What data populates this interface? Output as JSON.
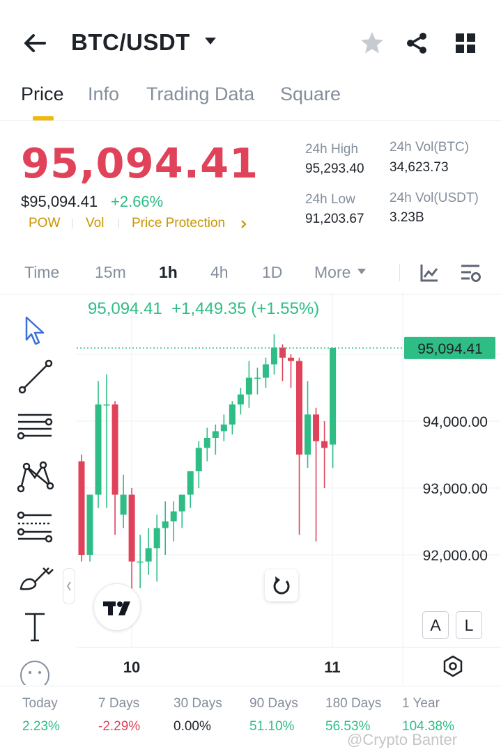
{
  "header": {
    "pair": "BTC/USDT",
    "icons": [
      "back-arrow-icon",
      "caret-down-icon",
      "star-icon",
      "share-icon",
      "grid-icon"
    ]
  },
  "tabs": [
    {
      "label": "Price",
      "active": true
    },
    {
      "label": "Info",
      "active": false
    },
    {
      "label": "Trading Data",
      "active": false
    },
    {
      "label": "Square",
      "active": false
    }
  ],
  "price": {
    "last": "95,094.41",
    "usd": "$95,094.41",
    "change_pct": "+2.66%",
    "tags": [
      "POW",
      "Vol",
      "Price Protection"
    ]
  },
  "stats": {
    "high_label": "24h High",
    "high_value": "95,293.40",
    "low_label": "24h Low",
    "low_value": "91,203.67",
    "vol_btc_label": "24h Vol(BTC)",
    "vol_btc_value": "34,623.73",
    "vol_usdt_label": "24h Vol(USDT)",
    "vol_usdt_value": "3.23B"
  },
  "intervals": [
    {
      "label": "Time",
      "active": false
    },
    {
      "label": "15m",
      "active": false
    },
    {
      "label": "1h",
      "active": true
    },
    {
      "label": "4h",
      "active": false
    },
    {
      "label": "1D",
      "active": false
    },
    {
      "label": "More",
      "active": false
    }
  ],
  "chart": {
    "ohlc_line": "95,094.41  +1,449.35 (+1.55%)",
    "current_price_label": "95,094.41",
    "reset_buttons": {
      "a": "A",
      "l": "L"
    },
    "x_ticks": [
      "10",
      "11"
    ]
  },
  "chart_data": {
    "type": "candlestick",
    "y_ticks": [
      92000,
      93000,
      94000
    ],
    "y_tick_labels": [
      "92,000.00",
      "93,000.00",
      "94,000.00"
    ],
    "current_price": 95094.41,
    "x_ticks": [
      "10",
      "11"
    ],
    "candles": [
      {
        "o": 93400,
        "h": 93500,
        "l": 91900,
        "c": 92000
      },
      {
        "o": 92000,
        "h": 92900,
        "l": 91900,
        "c": 92900
      },
      {
        "o": 92900,
        "h": 94600,
        "l": 92700,
        "c": 94250
      },
      {
        "o": 94250,
        "h": 94700,
        "l": 92700,
        "c": 94250
      },
      {
        "o": 94250,
        "h": 94300,
        "l": 92300,
        "c": 92900
      },
      {
        "o": 92600,
        "h": 93200,
        "l": 92400,
        "c": 92900
      },
      {
        "o": 92900,
        "h": 93000,
        "l": 91300,
        "c": 91900
      },
      {
        "o": 91900,
        "h": 92300,
        "l": 91500,
        "c": 91900
      },
      {
        "o": 91900,
        "h": 92400,
        "l": 91700,
        "c": 92100
      },
      {
        "o": 92100,
        "h": 92600,
        "l": 91600,
        "c": 92400
      },
      {
        "o": 92400,
        "h": 92800,
        "l": 92000,
        "c": 92500
      },
      {
        "o": 92500,
        "h": 92800,
        "l": 92200,
        "c": 92650
      },
      {
        "o": 92650,
        "h": 92900,
        "l": 92400,
        "c": 92900
      },
      {
        "o": 92900,
        "h": 93200,
        "l": 92700,
        "c": 93250
      },
      {
        "o": 93250,
        "h": 93700,
        "l": 93000,
        "c": 93600
      },
      {
        "o": 93600,
        "h": 93900,
        "l": 93400,
        "c": 93750
      },
      {
        "o": 93750,
        "h": 93950,
        "l": 93500,
        "c": 93850
      },
      {
        "o": 93850,
        "h": 94100,
        "l": 93700,
        "c": 93950
      },
      {
        "o": 93950,
        "h": 94300,
        "l": 93800,
        "c": 94250
      },
      {
        "o": 94250,
        "h": 94500,
        "l": 94100,
        "c": 94400
      },
      {
        "o": 94400,
        "h": 94900,
        "l": 94200,
        "c": 94650
      },
      {
        "o": 94650,
        "h": 94800,
        "l": 94400,
        "c": 94650
      },
      {
        "o": 94650,
        "h": 94950,
        "l": 94500,
        "c": 94850
      },
      {
        "o": 94850,
        "h": 95300,
        "l": 94700,
        "c": 95100
      },
      {
        "o": 95100,
        "h": 95150,
        "l": 94600,
        "c": 94950
      },
      {
        "o": 94950,
        "h": 95000,
        "l": 94500,
        "c": 94900
      },
      {
        "o": 94900,
        "h": 94950,
        "l": 92300,
        "c": 93500
      },
      {
        "o": 93500,
        "h": 94600,
        "l": 93300,
        "c": 94100
      },
      {
        "o": 94100,
        "h": 94200,
        "l": 92200,
        "c": 93700
      },
      {
        "o": 93700,
        "h": 94000,
        "l": 93000,
        "c": 93600
      },
      {
        "o": 93650,
        "h": 95100,
        "l": 93300,
        "c": 95094.41
      }
    ]
  },
  "performance": [
    {
      "label": "Today",
      "value": "2.23%",
      "tone": "pos"
    },
    {
      "label": "7 Days",
      "value": "-2.29%",
      "tone": "neg"
    },
    {
      "label": "30 Days",
      "value": "0.00%",
      "tone": "neu"
    },
    {
      "label": "90 Days",
      "value": "51.10%",
      "tone": "pos"
    },
    {
      "label": "180 Days",
      "value": "56.53%",
      "tone": "pos"
    },
    {
      "label": "1 Year",
      "value": "104.38%",
      "tone": "pos"
    }
  ],
  "watermark": "@Crypto Banter",
  "colors": {
    "up": "#2ebd85",
    "down": "#e0425a",
    "accent": "#f0b90b"
  }
}
